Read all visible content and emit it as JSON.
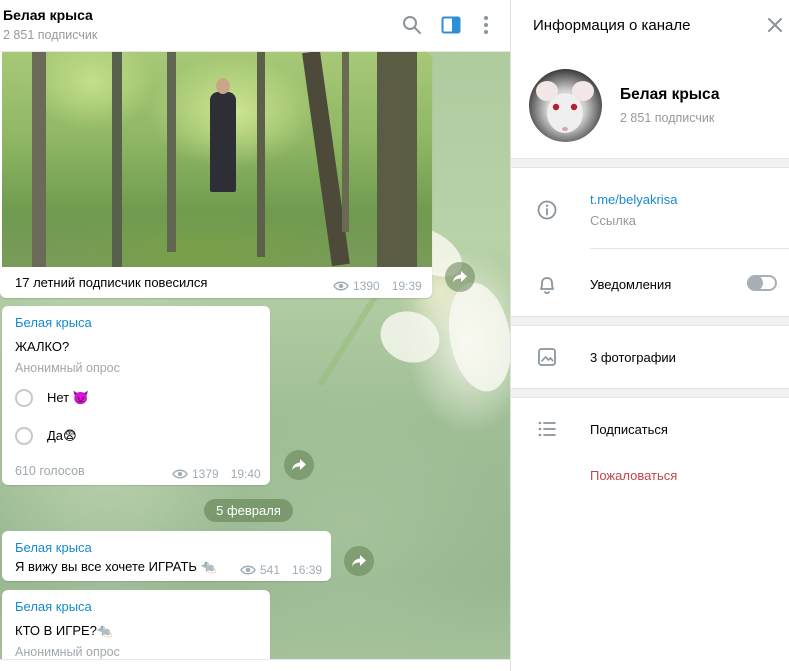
{
  "chat": {
    "title": "Белая крыса",
    "subscribers": "2 851 подписчик"
  },
  "messages": {
    "photo": {
      "caption": "17 летний  подписчик повесился",
      "views": "1390",
      "time": "19:39"
    },
    "poll1": {
      "sender": "Белая крыса",
      "question": "ЖАЛКО?",
      "type": "Анонимный опрос",
      "options": [
        "Нет 👿",
        "Да😨"
      ],
      "votes": "610 голосов",
      "views": "1379",
      "time": "19:40"
    },
    "date_separator": "5 февраля",
    "text_msg": {
      "sender": "Белая крыса",
      "text": "Я вижу вы все хочете ИГРАТЬ 🐀",
      "views": "541",
      "time": "16:39"
    },
    "poll2": {
      "sender": "Белая крыса",
      "question": "КТО В ИГРЕ?🐀",
      "type": "Анонимный опрос"
    }
  },
  "panel": {
    "title": "Информация о канале",
    "channel_name": "Белая крыса",
    "subscribers": "2 851 подписчик",
    "link": "t.me/belyakrisa",
    "link_label": "Ссылка",
    "notifications": "Уведомления",
    "notifications_enabled": false,
    "photos": "3 фотографии",
    "subscribe": "Подписаться",
    "report": "Пожаловаться"
  },
  "colors": {
    "accent": "#168acd",
    "report": "#c0474a",
    "muted": "#999999"
  },
  "icons": [
    "search-icon",
    "sidebar-toggle-icon",
    "more-vertical-icon",
    "close-icon",
    "eye-icon",
    "share-icon",
    "info-icon",
    "bell-icon",
    "image-icon",
    "list-icon"
  ]
}
